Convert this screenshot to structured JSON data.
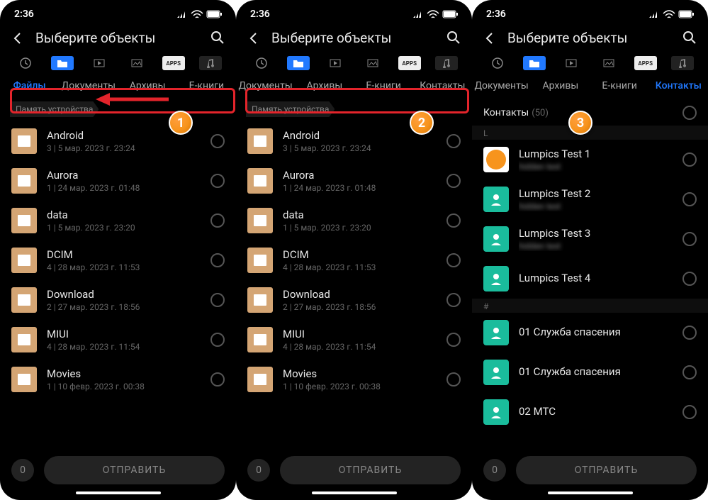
{
  "status": {
    "time": "2:36"
  },
  "header": {
    "title": "Выберите объекты"
  },
  "type_tabs": {
    "apps_label": "APPS"
  },
  "panel1": {
    "cats": [
      "Файлы",
      "Документы",
      "Архивы",
      "Е-книги"
    ],
    "breadcrumb": "Память устройства"
  },
  "panel2": {
    "cats": [
      "Документы",
      "Архивы",
      "Е-книги",
      "Контакты"
    ],
    "breadcrumb": "Память устройства"
  },
  "panel3": {
    "cats": [
      "Документы",
      "Архивы",
      "Е-книги",
      "Контакты"
    ],
    "section": "Контакты",
    "section_count": "(50)",
    "letter1": "L",
    "letter2": "#"
  },
  "folders": [
    {
      "name": "Android",
      "meta": "3 | 5 мар. 2023 г. 23:24"
    },
    {
      "name": "Aurora",
      "meta": "1 | 24 мар. 2023 г. 01:48"
    },
    {
      "name": "data",
      "meta": "1 | 5 мар. 2023 г. 23:20"
    },
    {
      "name": "DCIM",
      "meta": "4 | 28 мар. 2023 г. 11:53"
    },
    {
      "name": "Download",
      "meta": "2 | 27 мар. 2023 г. 18:56"
    },
    {
      "name": "MIUI",
      "meta": "4 | 28 мар. 2023 г. 11:54"
    },
    {
      "name": "Movies",
      "meta": "1 | 10 февр. 2023 г. 00:38"
    }
  ],
  "contacts": [
    {
      "name": "Lumpics Test 1",
      "sub": "hidden",
      "icon": "orange"
    },
    {
      "name": "Lumpics Test 2",
      "sub": "hidden",
      "icon": "person"
    },
    {
      "name": "Lumpics Test 3",
      "sub": "hidden",
      "icon": "person"
    },
    {
      "name": "Lumpics Test 4",
      "sub": "",
      "icon": "person"
    }
  ],
  "contacts2": [
    {
      "name": "01 Служба спасения"
    },
    {
      "name": "01 Служба спасения"
    },
    {
      "name": "02 МТС"
    }
  ],
  "bottom": {
    "count": "0",
    "send": "ОТПРАВИТЬ"
  },
  "markers": {
    "m1": "1",
    "m2": "2",
    "m3": "3"
  }
}
